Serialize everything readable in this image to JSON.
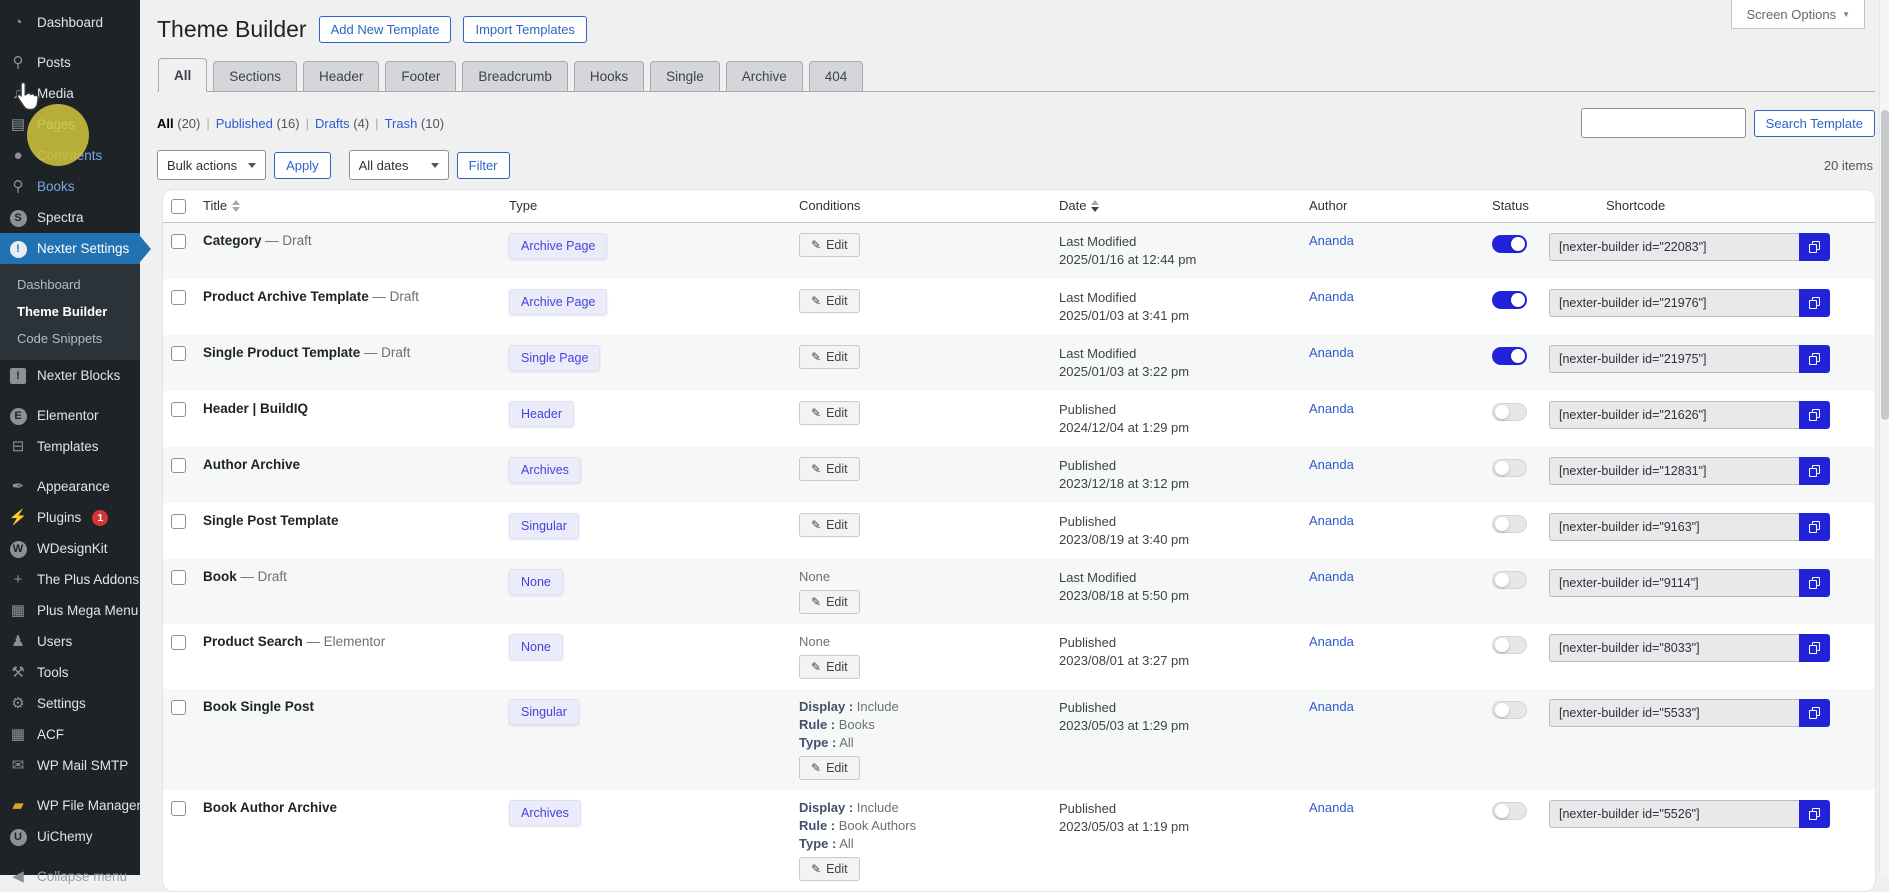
{
  "screen_options": {
    "label": "Screen Options"
  },
  "page": {
    "title": "Theme Builder"
  },
  "actions": {
    "add_new": "Add New Template",
    "import": "Import Templates"
  },
  "tabs": [
    {
      "label": "All",
      "active": true
    },
    {
      "label": "Sections"
    },
    {
      "label": "Header"
    },
    {
      "label": "Footer"
    },
    {
      "label": "Breadcrumb"
    },
    {
      "label": "Hooks"
    },
    {
      "label": "Single"
    },
    {
      "label": "Archive"
    },
    {
      "label": "404"
    }
  ],
  "views": [
    {
      "label": "All",
      "count": "(20)",
      "current": true
    },
    {
      "label": "Published",
      "count": "(16)"
    },
    {
      "label": "Drafts",
      "count": "(4)"
    },
    {
      "label": "Trash",
      "count": "(10)"
    }
  ],
  "filters": {
    "bulk_actions": "Bulk actions",
    "apply": "Apply",
    "all_dates": "All dates",
    "filter": "Filter",
    "items_count": "20 items"
  },
  "search": {
    "value": "",
    "button": "Search Template"
  },
  "table": {
    "edit_label": "Edit",
    "headers": {
      "title": "Title",
      "type": "Type",
      "conditions": "Conditions",
      "date": "Date",
      "author": "Author",
      "status": "Status",
      "shortcode": "Shortcode"
    },
    "rows": [
      {
        "title": "Category",
        "suffix": "— Draft",
        "type_badge": "Archive Page",
        "cond_plain": [],
        "cond_rules": [],
        "date_label": "Last Modified",
        "date_value": "2025/01/16 at 12:44 pm",
        "author": "Ananda",
        "status_on": true,
        "shortcode": "[nexter-builder id=\"22083\"]"
      },
      {
        "title": "Product Archive Template",
        "suffix": "— Draft",
        "type_badge": "Archive Page",
        "cond_plain": [],
        "cond_rules": [],
        "date_label": "Last Modified",
        "date_value": "2025/01/03 at 3:41 pm",
        "author": "Ananda",
        "status_on": true,
        "shortcode": "[nexter-builder id=\"21976\"]"
      },
      {
        "title": "Single Product Template",
        "suffix": "— Draft",
        "type_badge": "Single Page",
        "cond_plain": [],
        "cond_rules": [],
        "date_label": "Last Modified",
        "date_value": "2025/01/03 at 3:22 pm",
        "author": "Ananda",
        "status_on": true,
        "shortcode": "[nexter-builder id=\"21975\"]"
      },
      {
        "title": "Header | BuildIQ",
        "suffix": "",
        "type_badge": "Header",
        "cond_plain": [],
        "cond_rules": [],
        "date_label": "Published",
        "date_value": "2024/12/04 at 1:29 pm",
        "author": "Ananda",
        "status_on": false,
        "shortcode": "[nexter-builder id=\"21626\"]"
      },
      {
        "title": "Author Archive",
        "suffix": "",
        "type_badge": "Archives",
        "cond_plain": [],
        "cond_rules": [],
        "date_label": "Published",
        "date_value": "2023/12/18 at 3:12 pm",
        "author": "Ananda",
        "status_on": false,
        "shortcode": "[nexter-builder id=\"12831\"]"
      },
      {
        "title": "Single Post Template",
        "suffix": "",
        "type_badge": "Singular",
        "cond_plain": [],
        "cond_rules": [],
        "date_label": "Published",
        "date_value": "2023/08/19 at 3:40 pm",
        "author": "Ananda",
        "status_on": false,
        "shortcode": "[nexter-builder id=\"9163\"]"
      },
      {
        "title": "Book",
        "suffix": "— Draft",
        "type_badge": "None",
        "cond_plain": [
          "None"
        ],
        "cond_rules": [],
        "date_label": "Last Modified",
        "date_value": "2023/08/18 at 5:50 pm",
        "author": "Ananda",
        "status_on": false,
        "shortcode": "[nexter-builder id=\"9114\"]"
      },
      {
        "title": "Product Search",
        "suffix": "— Elementor",
        "type_badge": "None",
        "cond_plain": [
          "None"
        ],
        "cond_rules": [],
        "date_label": "Published",
        "date_value": "2023/08/01 at 3:27 pm",
        "author": "Ananda",
        "status_on": false,
        "shortcode": "[nexter-builder id=\"8033\"]"
      },
      {
        "title": "Book Single Post",
        "suffix": "",
        "type_badge": "Singular",
        "cond_plain": [],
        "cond_rules": [
          [
            "Display",
            "Include"
          ],
          [
            "Rule",
            "Books"
          ],
          [
            "Type",
            "All"
          ]
        ],
        "date_label": "Published",
        "date_value": "2023/05/03 at 1:29 pm",
        "author": "Ananda",
        "status_on": false,
        "shortcode": "[nexter-builder id=\"5533\"]"
      },
      {
        "title": "Book Author Archive",
        "suffix": "",
        "type_badge": "Archives",
        "cond_plain": [],
        "cond_rules": [
          [
            "Display",
            "Include"
          ],
          [
            "Rule",
            "Book Authors"
          ],
          [
            "Type",
            "All"
          ]
        ],
        "date_label": "Published",
        "date_value": "2023/05/03 at 1:19 pm",
        "author": "Ananda",
        "status_on": false,
        "shortcode": "[nexter-builder id=\"5526\"]"
      }
    ]
  },
  "sidebar": {
    "items": [
      {
        "name": "dashboard",
        "label": "Dashboard",
        "glyph": "◔"
      },
      {
        "name": "posts",
        "label": "Posts",
        "glyph": "⚲",
        "gap": true
      },
      {
        "name": "media",
        "label": "Media",
        "glyph": "♫"
      },
      {
        "name": "pages",
        "label": "Pages",
        "glyph": "▤"
      },
      {
        "name": "comments",
        "label": "Comments",
        "glyph": "●",
        "blue": true
      },
      {
        "name": "books",
        "label": "Books",
        "glyph": "⚲",
        "blue": true
      },
      {
        "name": "spectra",
        "label": "Spectra",
        "kind": "letter",
        "glyph": "S"
      },
      {
        "name": "nexter-settings",
        "label": "Nexter Settings",
        "kind": "bang-circle",
        "glyph": "!",
        "active": true,
        "has_submenu": true
      },
      {
        "name": "nexter-blocks",
        "label": "Nexter Blocks",
        "kind": "bang-square",
        "glyph": "!"
      },
      {
        "name": "elementor",
        "label": "Elementor",
        "kind": "letter",
        "glyph": "E",
        "gap": true
      },
      {
        "name": "templates",
        "label": "Templates",
        "glyph": "⊟"
      },
      {
        "name": "appearance",
        "label": "Appearance",
        "glyph": "✒",
        "gap": true
      },
      {
        "name": "plugins",
        "label": "Plugins",
        "glyph": "⚡",
        "badge": "1"
      },
      {
        "name": "wdesignkit",
        "label": "WDesignKit",
        "kind": "letter",
        "glyph": "W"
      },
      {
        "name": "the-plus-addons",
        "label": "The Plus Addons",
        "glyph": "+"
      },
      {
        "name": "plus-mega-menu",
        "label": "Plus Mega Menu",
        "glyph": "▦"
      },
      {
        "name": "users",
        "label": "Users",
        "glyph": "♟"
      },
      {
        "name": "tools",
        "label": "Tools",
        "glyph": "⚒"
      },
      {
        "name": "settings",
        "label": "Settings",
        "glyph": "⚙"
      },
      {
        "name": "acf",
        "label": "ACF",
        "glyph": "▦"
      },
      {
        "name": "wp-mail-smtp",
        "label": "WP Mail SMTP",
        "glyph": "✉"
      },
      {
        "name": "wp-file-manager",
        "label": "WP File Manager",
        "glyph": "▰",
        "orange": true,
        "gap": true
      },
      {
        "name": "uichemy",
        "label": "UiChemy",
        "kind": "letter",
        "glyph": "U"
      },
      {
        "name": "collapse-menu",
        "label": "Collapse menu",
        "glyph": "◀",
        "dim": true,
        "gap": true
      }
    ],
    "submenu": [
      {
        "name": "dashboard",
        "label": "Dashboard"
      },
      {
        "name": "theme-builder",
        "label": "Theme Builder",
        "current": true
      },
      {
        "name": "code-snippets",
        "label": "Code Snippets"
      }
    ]
  },
  "colors": {
    "wp_active_blue": "#2271b1",
    "accent_blue": "#2222d8",
    "link_blue": "#2d5bd0",
    "badge_red": "#d63638",
    "highlight_yellow": "#cdc23c"
  }
}
